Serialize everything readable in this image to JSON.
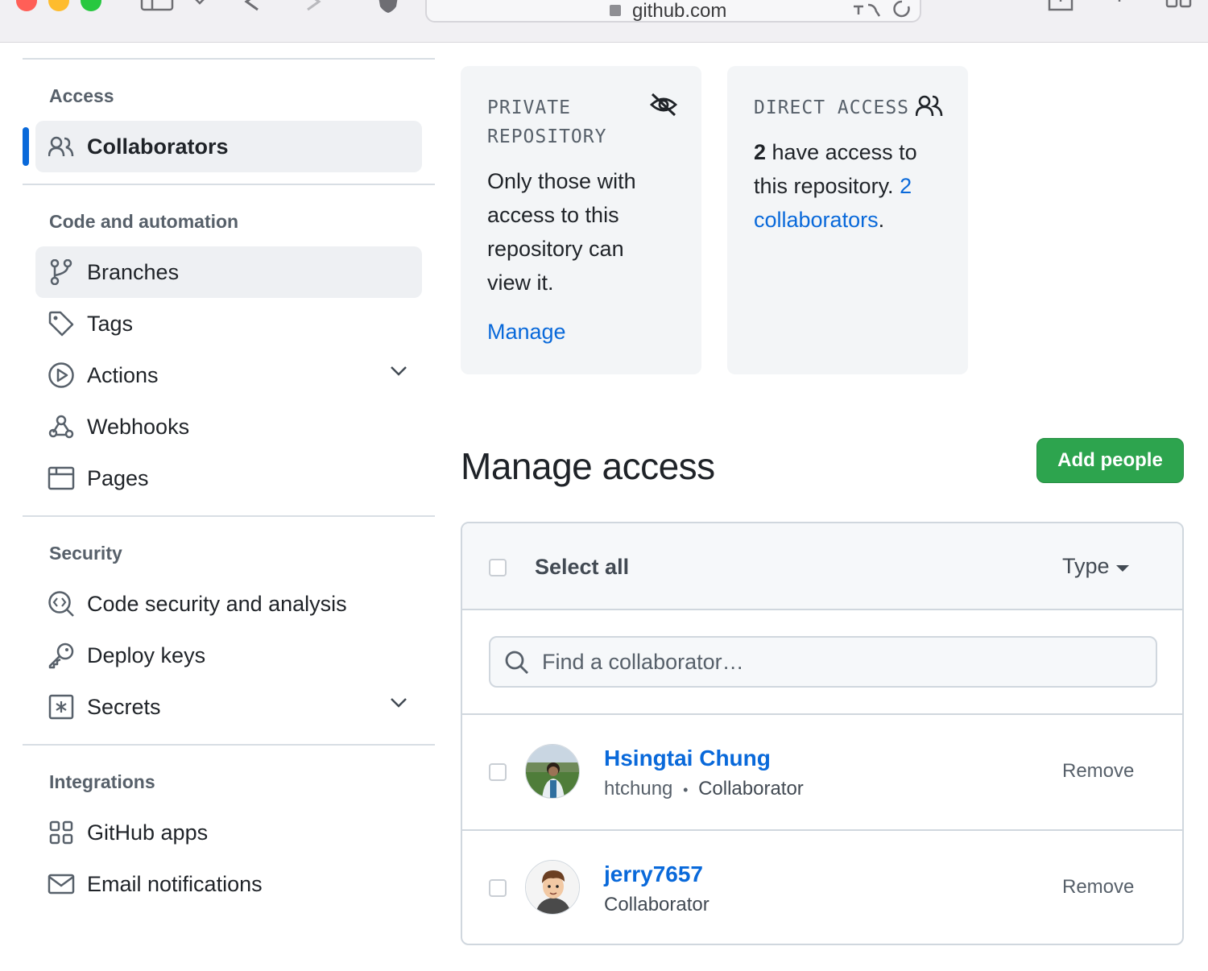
{
  "browser": {
    "url": "github.com"
  },
  "sidebar": {
    "sections": [
      {
        "title": "Access"
      },
      {
        "title": "Code and automation"
      },
      {
        "title": "Security"
      },
      {
        "title": "Integrations"
      }
    ],
    "items": [
      {
        "label": "Collaborators",
        "icon": "people-icon",
        "active": true
      },
      {
        "label": "Branches",
        "icon": "git-branch-icon"
      },
      {
        "label": "Tags",
        "icon": "tag-icon"
      },
      {
        "label": "Actions",
        "icon": "play-icon",
        "expandable": true
      },
      {
        "label": "Webhooks",
        "icon": "webhook-icon"
      },
      {
        "label": "Pages",
        "icon": "browser-icon"
      },
      {
        "label": "Code security and analysis",
        "icon": "codescan-icon"
      },
      {
        "label": "Deploy keys",
        "icon": "key-icon"
      },
      {
        "label": "Secrets",
        "icon": "secret-icon",
        "expandable": true
      },
      {
        "label": "GitHub apps",
        "icon": "apps-icon"
      },
      {
        "label": "Email notifications",
        "icon": "mail-icon"
      }
    ]
  },
  "cards": {
    "private": {
      "title_line1": "PRIVATE",
      "title_line2": "REPOSITORY",
      "text": [
        "Only those with",
        "access to this",
        "repository can",
        "view it."
      ],
      "link": "Manage"
    },
    "direct": {
      "title": "DIRECT ACCESS",
      "count": "2",
      "line1_rest": " have access to",
      "line2_start": "this repository. ",
      "line2_link": "2",
      "line3_link": "collaborators",
      "line3_end": "."
    }
  },
  "manage": {
    "heading": "Manage access",
    "add_button": "Add people",
    "select_all": "Select all",
    "type_filter": "Type",
    "search_placeholder": "Find a collaborator…",
    "collaborators": [
      {
        "name": "Hsingtai Chung",
        "login": "htchung",
        "separator": "•",
        "role": "Collaborator",
        "action": "Remove"
      },
      {
        "name": "jerry7657",
        "login": "",
        "role": "Collaborator",
        "action": "Remove"
      }
    ]
  },
  "colors": {
    "accent": "#0969da",
    "primary_button": "#2da44e",
    "card_bg": "#f3f5f7"
  }
}
